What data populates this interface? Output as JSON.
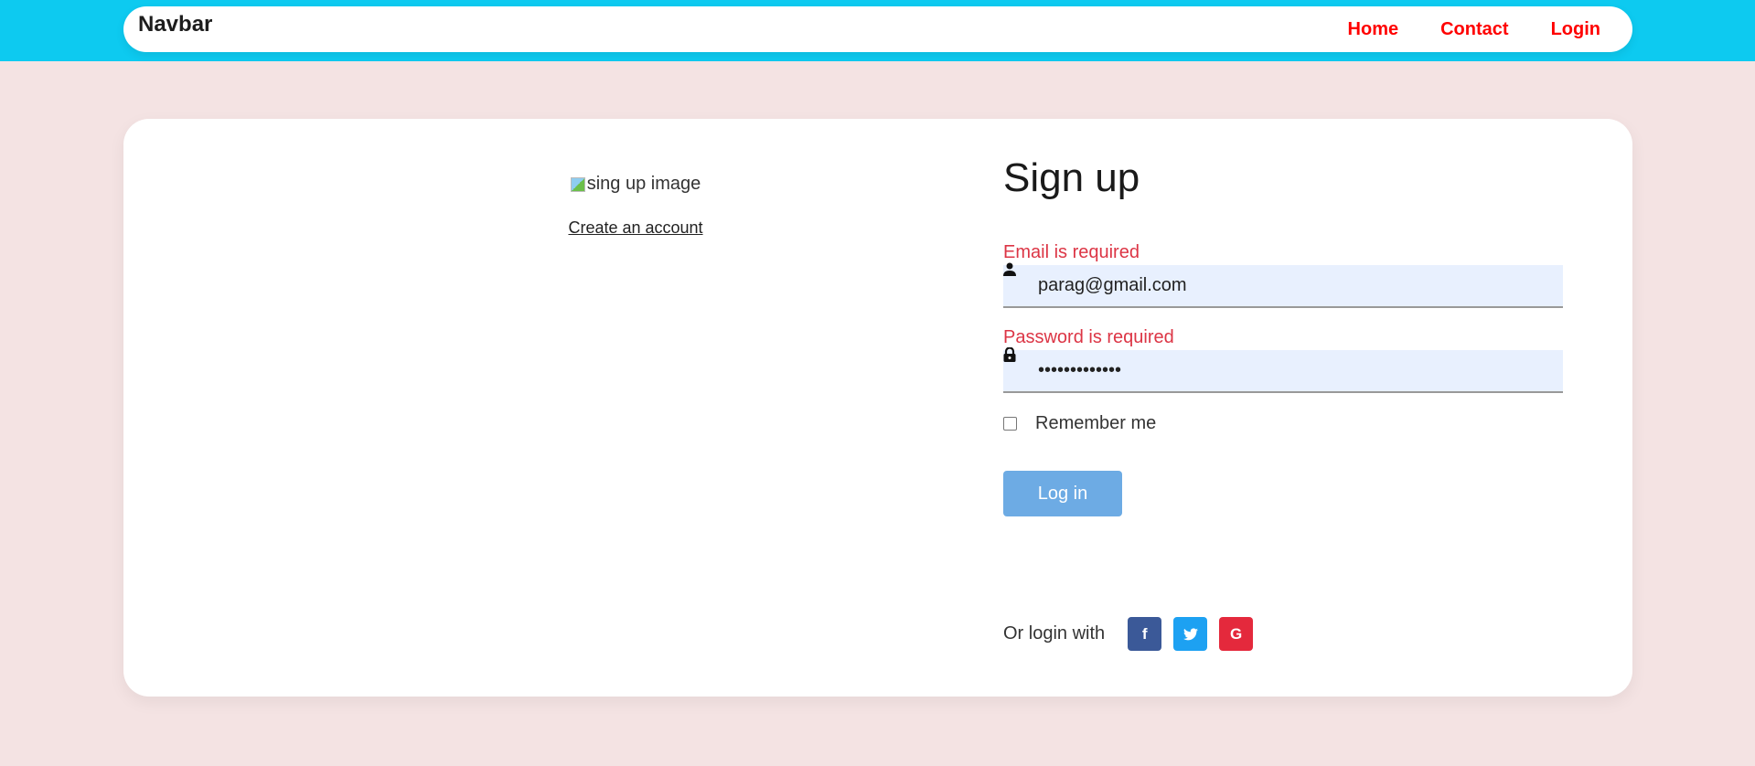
{
  "navbar": {
    "brand": "Navbar",
    "links": [
      "Home",
      "Contact",
      "Login"
    ],
    "background": "#0dcaf0",
    "link_color": "#ff0000"
  },
  "left": {
    "image_alt": "sing up image",
    "create_link": "Create an account"
  },
  "form": {
    "title": "Sign up",
    "email_error": "Email is required",
    "email_value": "parag@gmail.com",
    "password_error": "Password is required",
    "password_value": "•••••••••••••",
    "remember_label": "Remember me",
    "remember_checked": false,
    "login_button": "Log in",
    "error_color": "#dc3545",
    "button_color": "#6dabe4"
  },
  "social": {
    "label": "Or login with",
    "buttons": [
      {
        "name": "facebook",
        "icon": "facebook-icon",
        "glyph": "f",
        "color": "#3b5998"
      },
      {
        "name": "twitter",
        "icon": "twitter-icon",
        "glyph": "🐦",
        "color": "#1da1f2"
      },
      {
        "name": "google",
        "icon": "google-icon",
        "glyph": "G",
        "color": "#e4293c"
      }
    ]
  }
}
